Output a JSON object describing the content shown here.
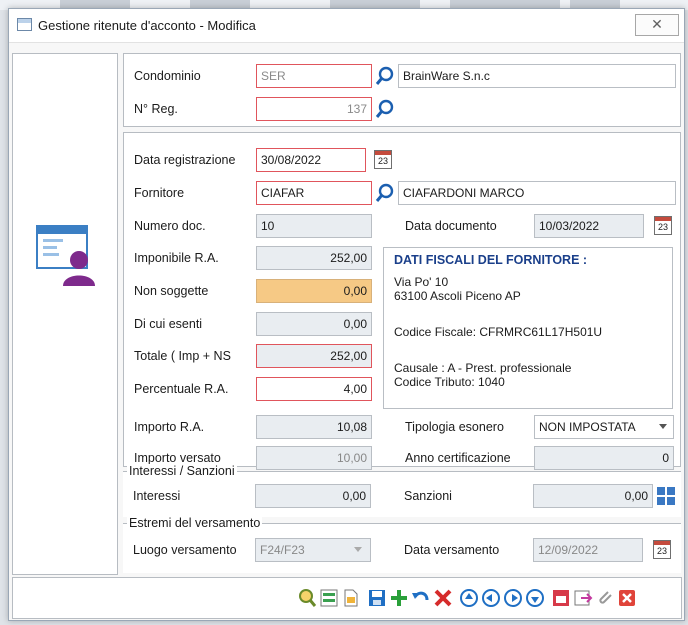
{
  "window": {
    "title": "Gestione ritenute d'acconto - Modifica",
    "close_glyph": "✕"
  },
  "header": {
    "condominio": {
      "label": "Condominio",
      "code": "SER",
      "name": "BrainWare S.n.c"
    },
    "nreg": {
      "label": "N° Reg.",
      "value": "137"
    }
  },
  "main": {
    "data_registrazione": {
      "label": "Data registrazione",
      "value": "30/08/2022",
      "calendar_text": "23"
    },
    "fornitore": {
      "label": "Fornitore",
      "code": "CIAFAR",
      "name": "CIAFARDONI MARCO"
    },
    "numero_doc": {
      "label": "Numero doc.",
      "value": "10"
    },
    "data_documento": {
      "label": "Data documento",
      "value": "10/03/2022",
      "calendar_text": "23"
    },
    "imponibile": {
      "label": "Imponibile R.A.",
      "value": "252,00"
    },
    "non_soggette": {
      "label": "Non soggette",
      "value": "0,00"
    },
    "di_cui_esenti": {
      "label": "Di cui esenti",
      "value": "0,00"
    },
    "totale": {
      "label": "Totale ( Imp + NS",
      "value": "252,00"
    },
    "percentuale": {
      "label": "Percentuale R.A.",
      "value": "4,00"
    },
    "importo_ra": {
      "label": "Importo R.A.",
      "value": "10,08"
    },
    "importo_versato": {
      "label": "Importo versato",
      "value": "10,00"
    },
    "tipologia_esonero": {
      "label": "Tipologia esonero",
      "value": "NON IMPOSTATA"
    },
    "anno_certificazione": {
      "label": "Anno certificazione",
      "value": "0"
    },
    "fiscal": {
      "heading": "DATI FISCALI DEL FORNITORE :",
      "address1": "Via Po' 10",
      "address2": "63100 Ascoli Piceno AP",
      "codice_fiscale": "Codice Fiscale: CFRMRC61L17H501U",
      "causale": "Causale : A  - Prest. professionale",
      "codice_tributo": "Codice Tributo: 1040"
    }
  },
  "interessi": {
    "group_title": "Interessi / Sanzioni",
    "interessi": {
      "label": "Interessi",
      "value": "0,00"
    },
    "sanzioni": {
      "label": "Sanzioni",
      "value": "0,00"
    }
  },
  "versamento": {
    "group_title": "Estremi del versamento",
    "luogo": {
      "label": "Luogo versamento",
      "value": "F24/F23"
    },
    "data": {
      "label": "Data versamento",
      "value": "12/09/2022",
      "calendar_text": "23"
    }
  },
  "toolbar": {
    "icons": [
      "search-icon",
      "refresh-icon",
      "document-icon",
      "save-icon",
      "add-icon",
      "undo-icon",
      "delete-icon",
      "first-record-icon",
      "previous-record-icon",
      "next-record-icon",
      "last-record-icon",
      "calendar-report-icon",
      "export-icon",
      "attach-icon",
      "close-icon"
    ]
  },
  "colors": {
    "required_border": "#e0555c",
    "highlight_field": "#f6c985",
    "accent_blue": "#1a3f8a"
  }
}
